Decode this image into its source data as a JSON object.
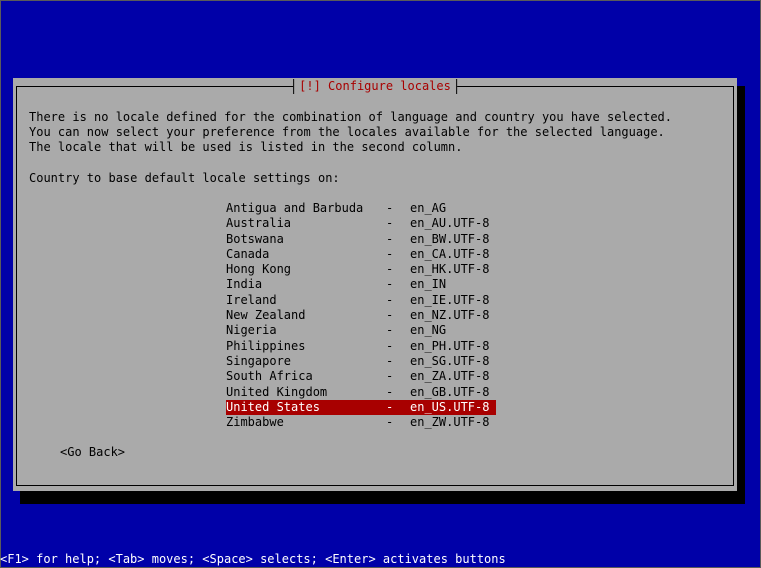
{
  "dialog": {
    "title": "[!] Configure locales",
    "description": "There is no locale defined for the combination of language and country you have selected.\nYou can now select your preference from the locales available for the selected language.\nThe locale that will be used is listed in the second column.",
    "prompt": "Country to base default locale settings on:",
    "separator": "-",
    "locales": [
      {
        "country": "Antigua and Barbuda",
        "code": "en_AG"
      },
      {
        "country": "Australia",
        "code": "en_AU.UTF-8"
      },
      {
        "country": "Botswana",
        "code": "en_BW.UTF-8"
      },
      {
        "country": "Canada",
        "code": "en_CA.UTF-8"
      },
      {
        "country": "Hong Kong",
        "code": "en_HK.UTF-8"
      },
      {
        "country": "India",
        "code": "en_IN"
      },
      {
        "country": "Ireland",
        "code": "en_IE.UTF-8"
      },
      {
        "country": "New Zealand",
        "code": "en_NZ.UTF-8"
      },
      {
        "country": "Nigeria",
        "code": "en_NG"
      },
      {
        "country": "Philippines",
        "code": "en_PH.UTF-8"
      },
      {
        "country": "Singapore",
        "code": "en_SG.UTF-8"
      },
      {
        "country": "South Africa",
        "code": "en_ZA.UTF-8"
      },
      {
        "country": "United Kingdom",
        "code": "en_GB.UTF-8"
      },
      {
        "country": "United States",
        "code": "en_US.UTF-8"
      },
      {
        "country": "Zimbabwe",
        "code": "en_ZW.UTF-8"
      }
    ],
    "selected_country": "United States",
    "go_back_label": "<Go Back>"
  },
  "help_bar": "<F1> for help; <Tab> moves; <Space> selects; <Enter> activates buttons",
  "colors": {
    "background": "#0000a8",
    "dialog": "#aaaaaa",
    "title": "#a80000",
    "selection": "#a80000"
  }
}
